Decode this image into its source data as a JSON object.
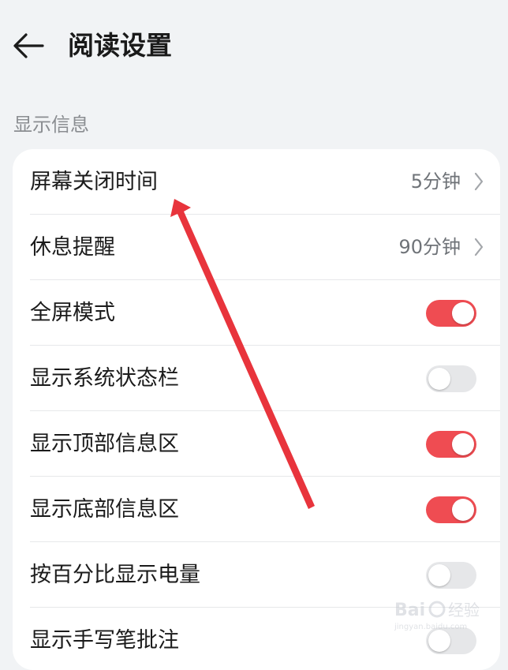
{
  "header": {
    "title": "阅读设置",
    "back_icon": "back-arrow-icon"
  },
  "section": {
    "label": "显示信息"
  },
  "rows": [
    {
      "label": "屏幕关闭时间",
      "type": "nav",
      "value": "5分钟"
    },
    {
      "label": "休息提醒",
      "type": "nav",
      "value": "90分钟"
    },
    {
      "label": "全屏模式",
      "type": "toggle",
      "on": true
    },
    {
      "label": "显示系统状态栏",
      "type": "toggle",
      "on": false
    },
    {
      "label": "显示顶部信息区",
      "type": "toggle",
      "on": true
    },
    {
      "label": "显示底部信息区",
      "type": "toggle",
      "on": true
    },
    {
      "label": "按百分比显示电量",
      "type": "toggle",
      "on": false
    },
    {
      "label": "显示手写笔批注",
      "type": "toggle",
      "on": false
    }
  ],
  "watermark": {
    "brand": "Bai du 经验",
    "url": "jingyan.baidu.com"
  },
  "colors": {
    "toggle_on": "#ef4c52",
    "toggle_off": "#e6e7e9",
    "annotation_arrow": "#e8343c",
    "background": "#f1f3f5"
  }
}
